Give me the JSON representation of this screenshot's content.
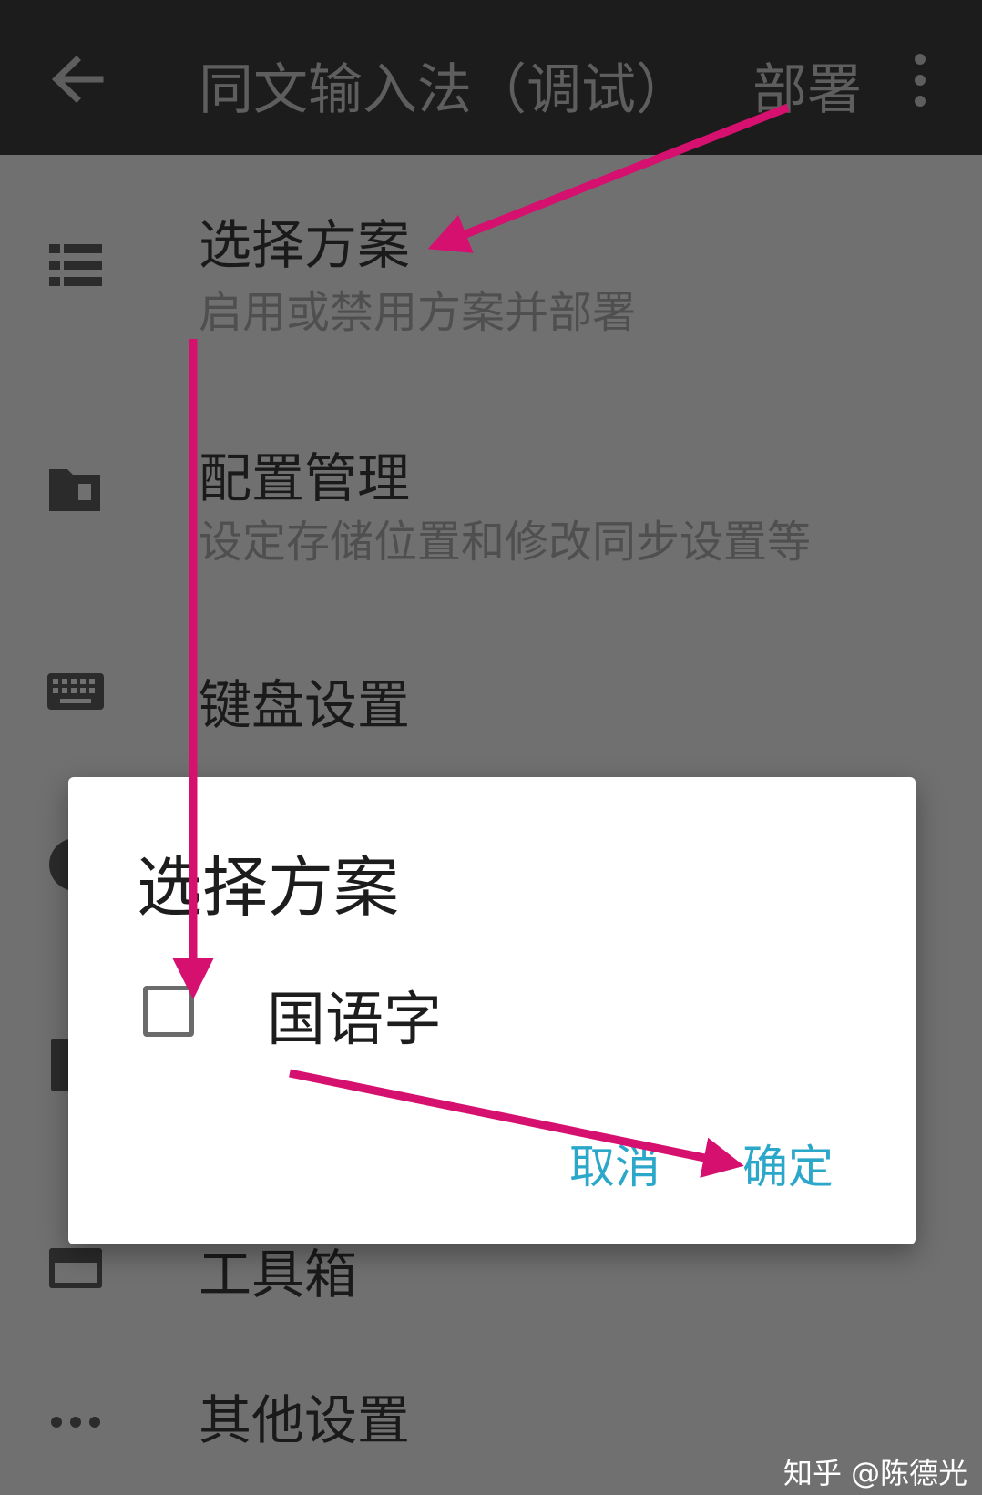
{
  "appbar": {
    "back_icon": "arrow-back-icon",
    "title": "同文输入法（调试）",
    "deploy_label": "部署",
    "more_icon": "more-vert-icon"
  },
  "menu": {
    "items": [
      {
        "icon": "list-icon",
        "title": "选择方案",
        "subtitle": "启用或禁用方案并部署"
      },
      {
        "icon": "folder-icon",
        "title": "配置管理",
        "subtitle": "设定存储位置和修改同步设置等"
      },
      {
        "icon": "keyboard-icon",
        "title": "键盘设置",
        "subtitle": ""
      },
      {
        "icon": "toolbox-icon",
        "title": "工具箱",
        "subtitle": ""
      },
      {
        "icon": "more-horiz-icon",
        "title": "其他设置",
        "subtitle": ""
      }
    ]
  },
  "dialog": {
    "title": "选择方案",
    "option_label": "国语字",
    "option_checked": false,
    "cancel_label": "取消",
    "ok_label": "确定"
  },
  "annotation_color": "#d6106f",
  "accent_color": "#2aa7c9",
  "watermark": "知乎 @陈德光"
}
